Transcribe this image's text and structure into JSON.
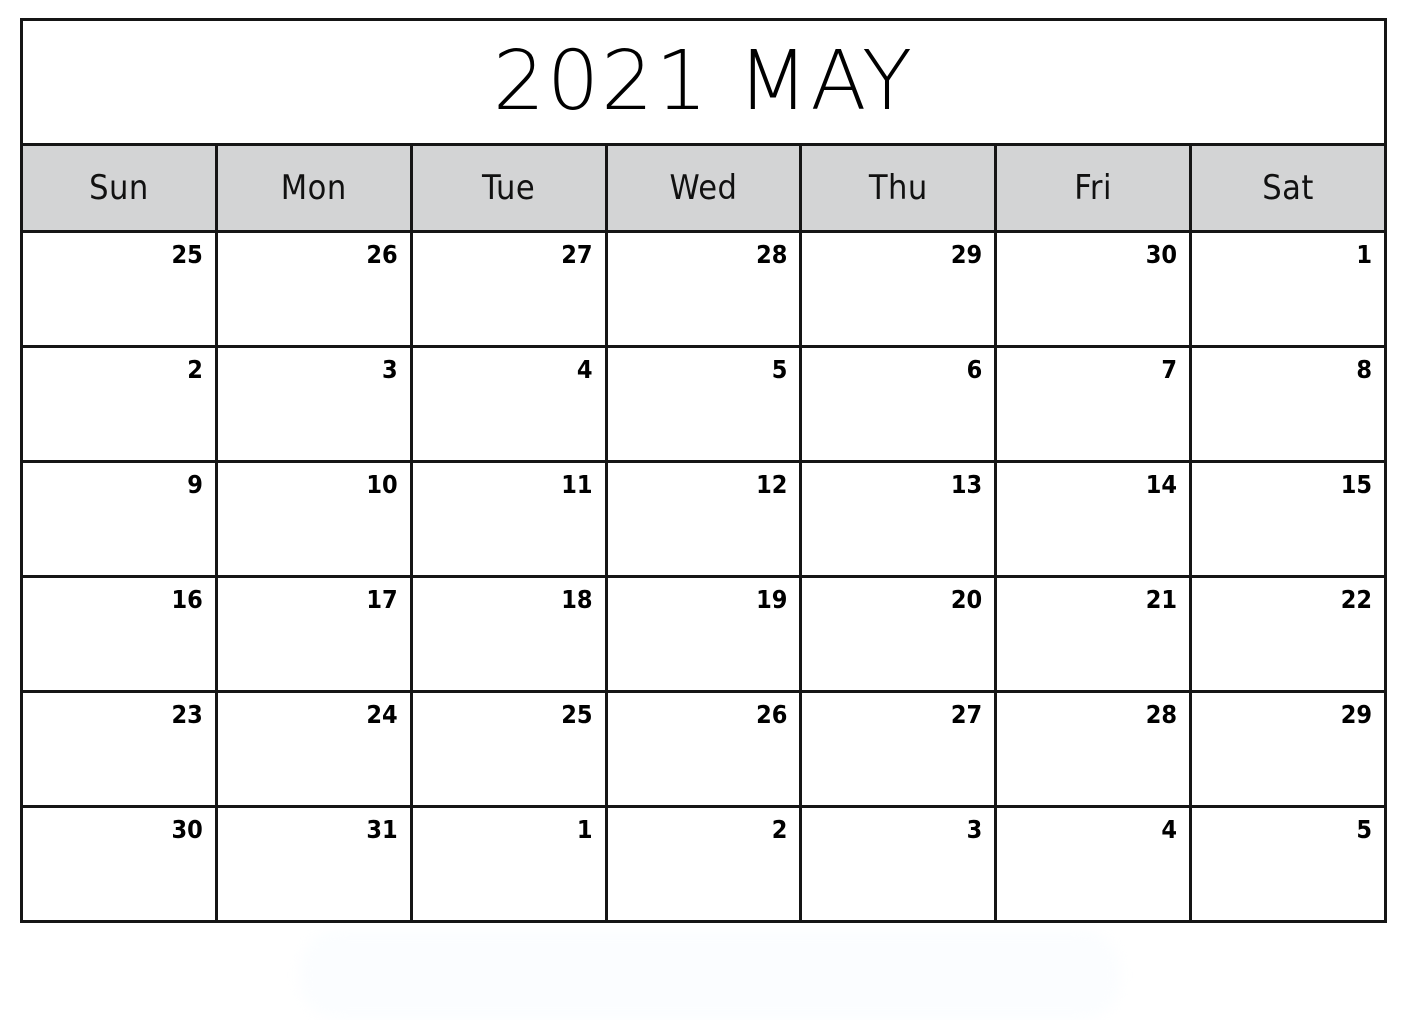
{
  "calendar": {
    "title": "2021 MAY",
    "year": "2021",
    "month": "MAY",
    "header_background": "#d3d4d5",
    "grid_color": "#151515",
    "page_background": "#ffffff",
    "weekdays": [
      {
        "label": "Sun"
      },
      {
        "label": "Mon"
      },
      {
        "label": "Tue"
      },
      {
        "label": "Wed"
      },
      {
        "label": "Thu"
      },
      {
        "label": "Fri"
      },
      {
        "label": "Sat"
      }
    ],
    "weeks": [
      {
        "days": [
          {
            "num": "25"
          },
          {
            "num": "26"
          },
          {
            "num": "27"
          },
          {
            "num": "28"
          },
          {
            "num": "29"
          },
          {
            "num": "30"
          },
          {
            "num": "1"
          }
        ]
      },
      {
        "days": [
          {
            "num": "2"
          },
          {
            "num": "3"
          },
          {
            "num": "4"
          },
          {
            "num": "5"
          },
          {
            "num": "6"
          },
          {
            "num": "7"
          },
          {
            "num": "8"
          }
        ]
      },
      {
        "days": [
          {
            "num": "9"
          },
          {
            "num": "10"
          },
          {
            "num": "11"
          },
          {
            "num": "12"
          },
          {
            "num": "13"
          },
          {
            "num": "14"
          },
          {
            "num": "15"
          }
        ]
      },
      {
        "days": [
          {
            "num": "16"
          },
          {
            "num": "17"
          },
          {
            "num": "18"
          },
          {
            "num": "19"
          },
          {
            "num": "20"
          },
          {
            "num": "21"
          },
          {
            "num": "22"
          }
        ]
      },
      {
        "days": [
          {
            "num": "23"
          },
          {
            "num": "24"
          },
          {
            "num": "25"
          },
          {
            "num": "26"
          },
          {
            "num": "27"
          },
          {
            "num": "28"
          },
          {
            "num": "29"
          }
        ]
      },
      {
        "days": [
          {
            "num": "30"
          },
          {
            "num": "31"
          },
          {
            "num": "1"
          },
          {
            "num": "2"
          },
          {
            "num": "3"
          },
          {
            "num": "4"
          },
          {
            "num": "5"
          }
        ]
      }
    ]
  }
}
